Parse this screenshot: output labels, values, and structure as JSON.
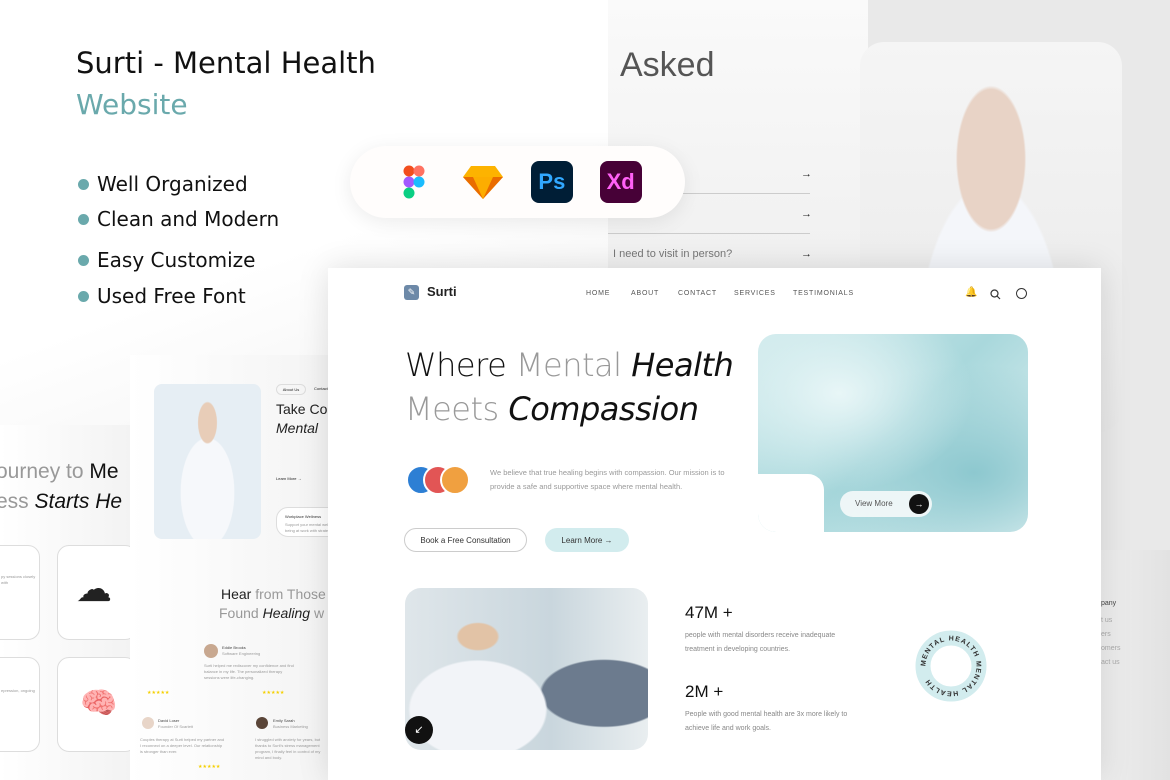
{
  "promo": {
    "title": "Surti - Mental Health",
    "subtitle": "Website",
    "features": [
      "Well Organized",
      "Clean and Modern",
      "Easy Customize",
      "Used Free Font"
    ],
    "accent": "#6aa9ac",
    "tools": [
      "figma-icon",
      "sketch-icon",
      "Ps",
      "Xd"
    ]
  },
  "faq": {
    "title": "Asked",
    "question3": "I need to visit in person?",
    "arrow": "→"
  },
  "site": {
    "brand": "Surti",
    "nav": [
      "HOME",
      "ABOUT",
      "CONTACT",
      "SERVICES",
      "TESTIMONIALS"
    ],
    "hero": {
      "w1": "Where",
      "w2": "Mental",
      "w3": "Health",
      "w4": "Meets",
      "w5": "Compassion"
    },
    "mission": "We believe that true healing begins with compassion. Our mission is to provide a safe and supportive space where mental health.",
    "book_btn": "Book a Free Consultation",
    "learn_btn": "Learn More →",
    "view_more": "View More",
    "arrow": "→",
    "stats": [
      {
        "value": "47M +",
        "desc": "people with mental disorders receive inadequate treatment in developing countries."
      },
      {
        "value": "2M +",
        "desc": "People with good mental health are 3x more likely to achieve life and work goals."
      }
    ],
    "badge_text": "MENTAL HEALTH MENTAL HEALTH "
  },
  "page2": {
    "tab1": "About Us",
    "tab2": "Contact",
    "hero1": "Take Co",
    "hero2": "Mental",
    "learn": "Learn More →",
    "card_title": "Workplace Wellness",
    "card_text": "Support your mental well-being at work with strategies",
    "test1": "Hear",
    "test2": "from Those",
    "test3": "Found",
    "test4": "Healing",
    "test5": "w",
    "reviewers": [
      {
        "name": "Eddie Brooks",
        "role": "Software Engineering",
        "text": "Surti helped me rediscover my confidence and find balance in my life. The personalized therapy sessions were life-changing."
      },
      {
        "name": "David Loser",
        "role": "Founder Of Scarlett",
        "text": "Couples therapy at Surti helped my partner and I reconnect on a deeper level. Our relationship is stronger than ever."
      },
      {
        "name": "Emily Sarah",
        "role": "Business Marketing",
        "text": "I struggled with anxiety for years, but thanks to Surti's stress management program, I finally feel in control of my mind and body."
      }
    ],
    "stars": "★★★★★"
  },
  "page3": {
    "h1a": "ourney to ",
    "h1b": "Me",
    "h2a": "ess ",
    "h2b": "Starts He",
    "c1": "py sessions closely with",
    "c2": "epression, ongoing"
  },
  "page4": {
    "heading": "pany",
    "links": [
      "t us",
      "ers",
      "omers",
      "act us"
    ]
  }
}
